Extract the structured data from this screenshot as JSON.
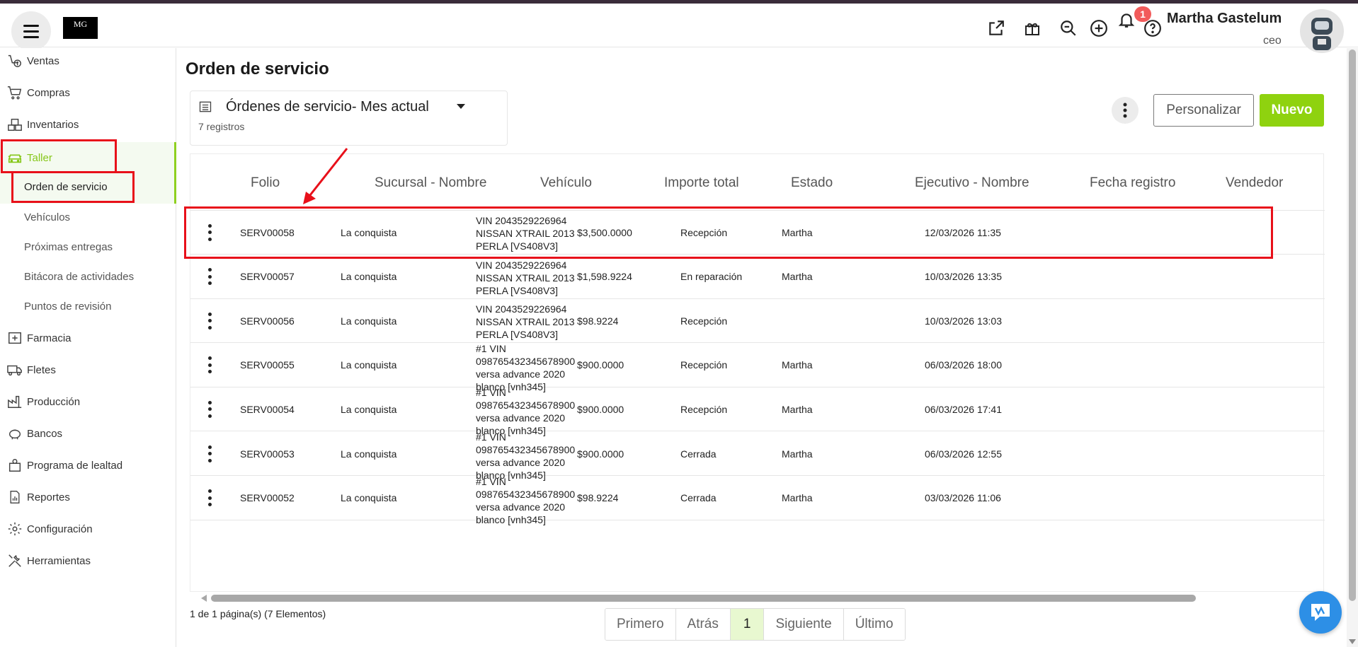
{
  "header": {
    "logo_text": "MG",
    "notifications_count": "1",
    "user_name": "Martha Gastelum",
    "user_role": "ceo"
  },
  "sidebar": {
    "items": [
      {
        "label": "Ventas",
        "icon": "sales-icon"
      },
      {
        "label": "Compras",
        "icon": "cart-icon"
      },
      {
        "label": "Inventarios",
        "icon": "boxes-icon"
      },
      {
        "label": "Taller",
        "icon": "car-icon",
        "active": true
      },
      {
        "label": "Farmacia",
        "icon": "pharmacy-icon"
      },
      {
        "label": "Fletes",
        "icon": "truck-icon"
      },
      {
        "label": "Producción",
        "icon": "factory-icon"
      },
      {
        "label": "Bancos",
        "icon": "piggy-bank-icon"
      },
      {
        "label": "Programa de lealtad",
        "icon": "loyalty-icon"
      },
      {
        "label": "Reportes",
        "icon": "report-icon"
      },
      {
        "label": "Configuración",
        "icon": "gear-icon"
      },
      {
        "label": "Herramientas",
        "icon": "tools-icon"
      }
    ],
    "taller_sub": [
      {
        "label": "Orden de servicio",
        "active": true
      },
      {
        "label": "Vehículos"
      },
      {
        "label": "Próximas entregas"
      },
      {
        "label": "Bitácora de actividades"
      },
      {
        "label": "Puntos de revisión"
      }
    ]
  },
  "main": {
    "title": "Orden de servicio",
    "view_name": "Órdenes de servicio- Mes actual",
    "record_count": "7 registros",
    "personalizar_label": "Personalizar",
    "nuevo_label": "Nuevo"
  },
  "table": {
    "columns": [
      "Folio",
      "Sucursal - Nombre",
      "Vehículo",
      "Importe total",
      "Estado",
      "Ejecutivo - Nombre",
      "Fecha registro",
      "Vendedor"
    ],
    "rows": [
      {
        "folio": "SERV00058",
        "sucursal": "La conquista",
        "vehiculo": [
          "VIN 2043529226964",
          "NISSAN XTRAIL 2013",
          "PERLA [VS408V3]"
        ],
        "importe": "$3,500.0000",
        "estado": "Recepción",
        "ejecutivo": "Martha",
        "fecha": "12/03/2026 11:35",
        "vendedor": ""
      },
      {
        "folio": "SERV00057",
        "sucursal": "La conquista",
        "vehiculo": [
          "VIN 2043529226964",
          "NISSAN XTRAIL 2013",
          "PERLA [VS408V3]"
        ],
        "importe": "$1,598.9224",
        "estado": "En reparación",
        "ejecutivo": "Martha",
        "fecha": "10/03/2026 13:35",
        "vendedor": ""
      },
      {
        "folio": "SERV00056",
        "sucursal": "La conquista",
        "vehiculo": [
          "VIN 2043529226964",
          "NISSAN XTRAIL 2013",
          "PERLA [VS408V3]"
        ],
        "importe": "$98.9224",
        "estado": "Recepción",
        "ejecutivo": "",
        "fecha": "10/03/2026 13:03",
        "vendedor": ""
      },
      {
        "folio": "SERV00055",
        "sucursal": "La conquista",
        "vehiculo": [
          "#1 VIN",
          "098765432345678900",
          "versa advance 2020",
          "blanco [vnh345]"
        ],
        "importe": "$900.0000",
        "estado": "Recepción",
        "ejecutivo": "Martha",
        "fecha": "06/03/2026 18:00",
        "vendedor": ""
      },
      {
        "folio": "SERV00054",
        "sucursal": "La conquista",
        "vehiculo": [
          "#1 VIN",
          "098765432345678900",
          "versa advance 2020",
          "blanco [vnh345]"
        ],
        "importe": "$900.0000",
        "estado": "Recepción",
        "ejecutivo": "Martha",
        "fecha": "06/03/2026 17:41",
        "vendedor": ""
      },
      {
        "folio": "SERV00053",
        "sucursal": "La conquista",
        "vehiculo": [
          "#1 VIN",
          "098765432345678900",
          "versa advance 2020",
          "blanco [vnh345]"
        ],
        "importe": "$900.0000",
        "estado": "Cerrada",
        "ejecutivo": "Martha",
        "fecha": "06/03/2026 12:55",
        "vendedor": ""
      },
      {
        "folio": "SERV00052",
        "sucursal": "La conquista",
        "vehiculo": [
          "#1 VIN",
          "098765432345678900",
          "versa advance 2020",
          "blanco [vnh345]"
        ],
        "importe": "$98.9224",
        "estado": "Cerrada",
        "ejecutivo": "Martha",
        "fecha": "03/03/2026 11:06",
        "vendedor": ""
      }
    ]
  },
  "pagination": {
    "info": "1 de 1 página(s) (7 Elementos)",
    "first": "Primero",
    "prev": "Atrás",
    "current": "1",
    "next": "Siguiente",
    "last": "Último"
  },
  "colors": {
    "accent_green": "#8fd20f",
    "annotation_red": "#e8101a",
    "badge_red": "#f25b5b",
    "chat_blue": "#2d8fe6"
  }
}
